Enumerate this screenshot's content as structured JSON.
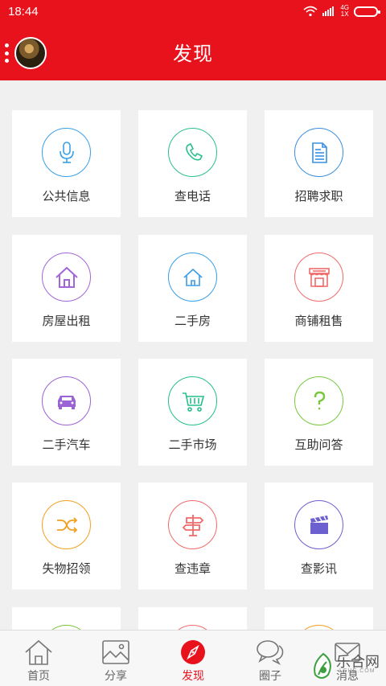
{
  "status_bar": {
    "time": "18:44",
    "network_top": "4G",
    "network_bottom": "1X"
  },
  "header": {
    "title": "发现"
  },
  "services": [
    {
      "label": "公共信息",
      "icon": "microphone-icon",
      "color": "#3aa0e8"
    },
    {
      "label": "查电话",
      "icon": "phone-icon",
      "color": "#2bc08e"
    },
    {
      "label": "招聘求职",
      "icon": "document-icon",
      "color": "#3a8fe0"
    },
    {
      "label": "房屋出租",
      "icon": "house-icon",
      "color": "#a266d8"
    },
    {
      "label": "二手房",
      "icon": "house-outline-icon",
      "color": "#3a9de8"
    },
    {
      "label": "商铺租售",
      "icon": "storefront-icon",
      "color": "#f06a6a"
    },
    {
      "label": "二手汽车",
      "icon": "car-icon",
      "color": "#9c63d6"
    },
    {
      "label": "二手市场",
      "icon": "shopping-cart-icon",
      "color": "#24c088"
    },
    {
      "label": "互助问答",
      "icon": "question-icon",
      "color": "#78c83c"
    },
    {
      "label": "失物招领",
      "icon": "shuffle-icon",
      "color": "#f2a020"
    },
    {
      "label": "查违章",
      "icon": "signpost-icon",
      "color": "#f06a6a"
    },
    {
      "label": "查影讯",
      "icon": "clapperboard-icon",
      "color": "#6c5fcf"
    }
  ],
  "tabs": [
    {
      "label": "首页",
      "icon": "home-icon",
      "active": false
    },
    {
      "label": "分享",
      "icon": "image-icon",
      "active": false
    },
    {
      "label": "发现",
      "icon": "compass-icon",
      "active": true
    },
    {
      "label": "圈子",
      "icon": "chat-bubbles-icon",
      "active": false
    },
    {
      "label": "消息",
      "icon": "envelope-icon",
      "active": false
    }
  ],
  "watermark": {
    "text": "乐合网",
    "sub": "LEHE.COM"
  }
}
